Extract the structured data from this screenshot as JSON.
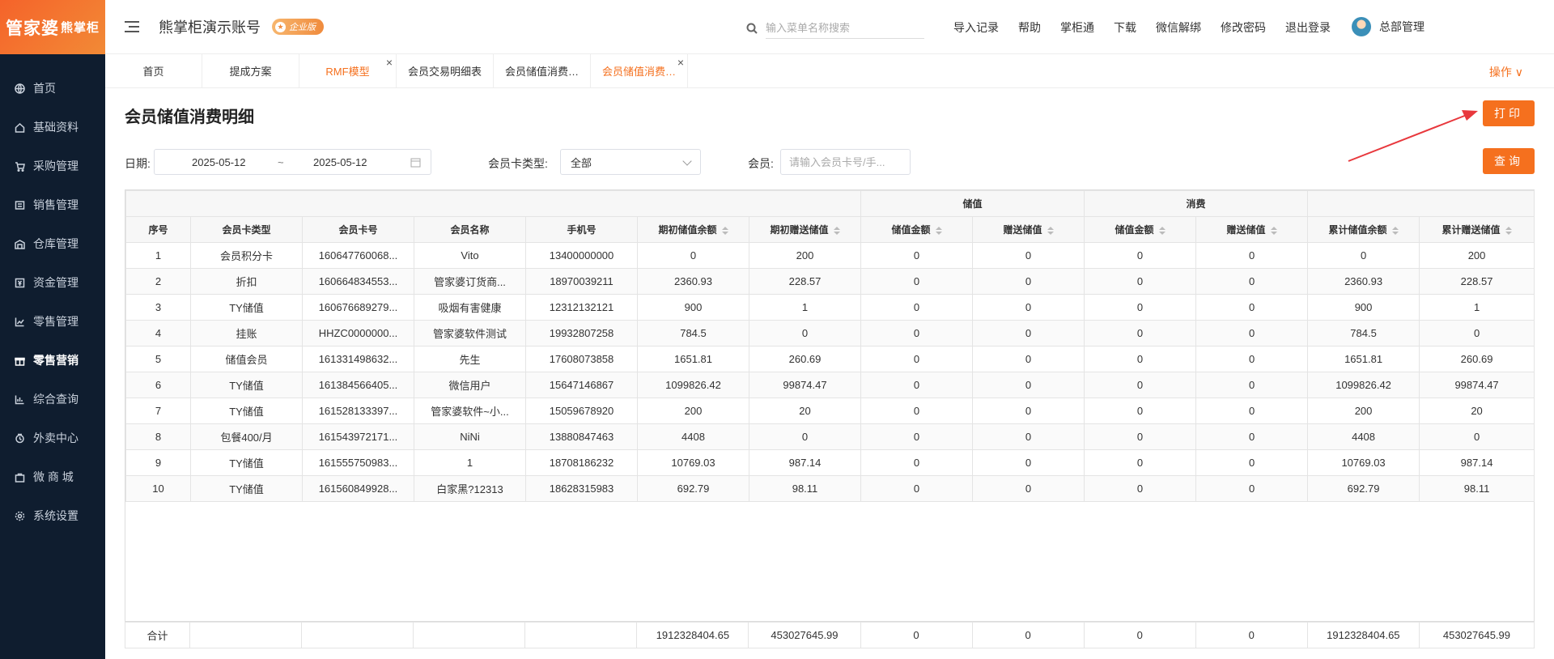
{
  "brand": {
    "logo_main": "管家婆",
    "logo_sub": "熊掌柜"
  },
  "sidebar": {
    "items": [
      {
        "label": "首页",
        "icon": "globe-icon"
      },
      {
        "label": "基础资料",
        "icon": "home-icon"
      },
      {
        "label": "采购管理",
        "icon": "cart-icon"
      },
      {
        "label": "销售管理",
        "icon": "sales-icon"
      },
      {
        "label": "仓库管理",
        "icon": "warehouse-icon"
      },
      {
        "label": "资金管理",
        "icon": "money-icon"
      },
      {
        "label": "零售管理",
        "icon": "chart-icon"
      },
      {
        "label": "零售营销",
        "icon": "gift-icon",
        "active": true
      },
      {
        "label": "综合查询",
        "icon": "bar-icon"
      },
      {
        "label": "外卖中心",
        "icon": "delivery-icon"
      },
      {
        "label": "微 商 城",
        "icon": "bag-icon"
      },
      {
        "label": "系统设置",
        "icon": "gear-icon"
      }
    ]
  },
  "header": {
    "account": "熊掌柜演示账号",
    "edition": "企业版",
    "search_placeholder": "输入菜单名称搜索",
    "links": [
      "导入记录",
      "帮助",
      "掌柜通",
      "下载",
      "微信解绑",
      "修改密码",
      "退出登录"
    ],
    "user": "总部管理"
  },
  "tabs": [
    {
      "label": "首页"
    },
    {
      "label": "提成方案"
    },
    {
      "label": "RMF模型",
      "orange": true,
      "close": "×"
    },
    {
      "label": "会员交易明细表"
    },
    {
      "label": "会员储值消费…"
    },
    {
      "label": "会员储值消费…",
      "orange": true,
      "close": "×"
    }
  ],
  "tab_ops": "操作 ∨",
  "page": {
    "title": "会员储值消费明细",
    "print": "打印",
    "query": "查询"
  },
  "filters": {
    "date_label": "日期:",
    "date_start": "2025-05-12",
    "date_sep": "~",
    "date_end": "2025-05-12",
    "card_type_label": "会员卡类型:",
    "card_type_value": "全部",
    "member_label": "会员:",
    "member_placeholder": "请输入会员卡号/手..."
  },
  "table": {
    "group_headers": {
      "stored": "储值",
      "consume": "消费"
    },
    "columns": [
      "序号",
      "会员卡类型",
      "会员卡号",
      "会员名称",
      "手机号",
      "期初储值余额",
      "期初赠送储值",
      "储值金额",
      "赠送储值",
      "储值金额",
      "赠送储值",
      "累计储值余额",
      "累计赠送储值"
    ],
    "rows": [
      [
        "1",
        "会员积分卡",
        "160647760068...",
        "Vito",
        "13400000000",
        "0",
        "200",
        "0",
        "0",
        "0",
        "0",
        "0",
        "200"
      ],
      [
        "2",
        "折扣",
        "160664834553...",
        "管家婆订货商...",
        "18970039211",
        "2360.93",
        "228.57",
        "0",
        "0",
        "0",
        "0",
        "2360.93",
        "228.57"
      ],
      [
        "3",
        "TY储值",
        "160676689279...",
        "吸烟有害健康",
        "12312132121",
        "900",
        "1",
        "0",
        "0",
        "0",
        "0",
        "900",
        "1"
      ],
      [
        "4",
        "挂账",
        "HHZC0000000...",
        "管家婆软件测试",
        "19932807258",
        "784.5",
        "0",
        "0",
        "0",
        "0",
        "0",
        "784.5",
        "0"
      ],
      [
        "5",
        "储值会员",
        "161331498632...",
        "先生",
        "17608073858",
        "1651.81",
        "260.69",
        "0",
        "0",
        "0",
        "0",
        "1651.81",
        "260.69"
      ],
      [
        "6",
        "TY储值",
        "161384566405...",
        "微信用户",
        "15647146867",
        "1099826.42",
        "99874.47",
        "0",
        "0",
        "0",
        "0",
        "1099826.42",
        "99874.47"
      ],
      [
        "7",
        "TY储值",
        "161528133397...",
        "管家婆软件~小...",
        "15059678920",
        "200",
        "20",
        "0",
        "0",
        "0",
        "0",
        "200",
        "20"
      ],
      [
        "8",
        "包餐400/月",
        "161543972171...",
        "NiNi",
        "13880847463",
        "4408",
        "0",
        "0",
        "0",
        "0",
        "0",
        "4408",
        "0"
      ],
      [
        "9",
        "TY储值",
        "161555750983...",
        "1",
        "18708186232",
        "10769.03",
        "987.14",
        "0",
        "0",
        "0",
        "0",
        "10769.03",
        "987.14"
      ],
      [
        "10",
        "TY储值",
        "161560849928...",
        "白家黑?12313",
        "18628315983",
        "692.79",
        "98.11",
        "0",
        "0",
        "0",
        "0",
        "692.79",
        "98.11"
      ]
    ],
    "footer": [
      "合计",
      "",
      "",
      "",
      "",
      "1912328404.65",
      "453027645.99",
      "0",
      "0",
      "0",
      "0",
      "1912328404.65",
      "453027645.99"
    ]
  },
  "colors": {
    "accent": "#f5701e",
    "sidebar": "#0f1d2f"
  }
}
